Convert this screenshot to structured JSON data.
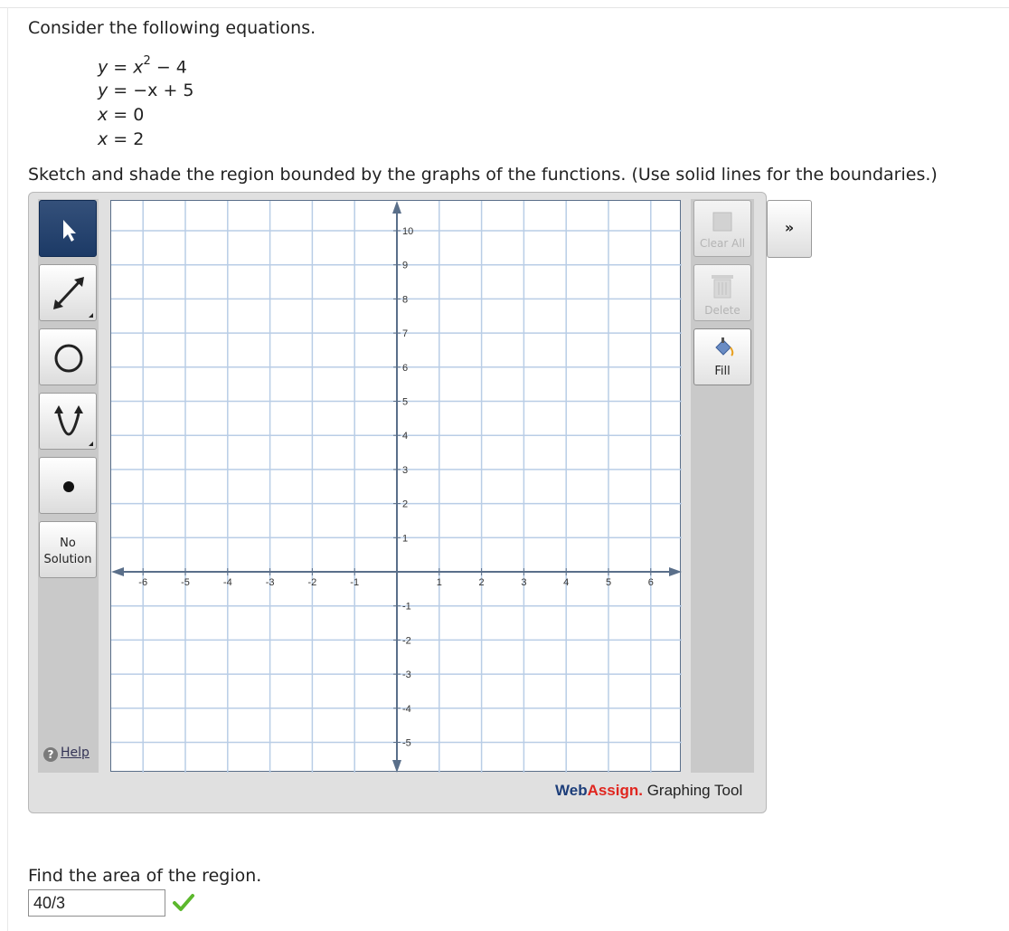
{
  "intro": "Consider the following equations.",
  "equations": [
    {
      "var": "y",
      "op": " = ",
      "base": "x",
      "sup": "2",
      "rest": " − 4"
    },
    {
      "var": "y",
      "op": " = ",
      "base": "−x + 5",
      "sup": "",
      "rest": ""
    },
    {
      "var": "x",
      "op": " = ",
      "base": "0",
      "sup": "",
      "rest": ""
    },
    {
      "var": "x",
      "op": " = ",
      "base": "2",
      "sup": "",
      "rest": ""
    }
  ],
  "instruction": "Sketch and shade the region bounded by the graphs of the functions. (Use solid lines for the boundaries.)",
  "tools": {
    "no_solution_line1": "No",
    "no_solution_line2": "Solution",
    "help_label": "Help"
  },
  "right_buttons": {
    "clear_all": "Clear All",
    "delete": "Delete",
    "fill": "Fill",
    "expand": "»"
  },
  "graph": {
    "x_ticks": [
      "-6",
      "-5",
      "-4",
      "-3",
      "-2",
      "-1",
      "1",
      "2",
      "3",
      "4",
      "5",
      "6"
    ],
    "y_ticks": [
      "10",
      "9",
      "8",
      "7",
      "6",
      "5",
      "4",
      "3",
      "2",
      "1",
      "-1",
      "-2",
      "-3",
      "-4",
      "-5"
    ]
  },
  "brand": {
    "web": "Web",
    "assign": "Assign.",
    "tool": " Graphing Tool"
  },
  "question": "Find the area of the region.",
  "answer_value": "40/3",
  "colors": {
    "accent": "#1c3a66",
    "grid": "#b9cde6",
    "axis": "#5a6f8a",
    "correct": "#5cb82d",
    "brand_red": "#e0261f"
  }
}
